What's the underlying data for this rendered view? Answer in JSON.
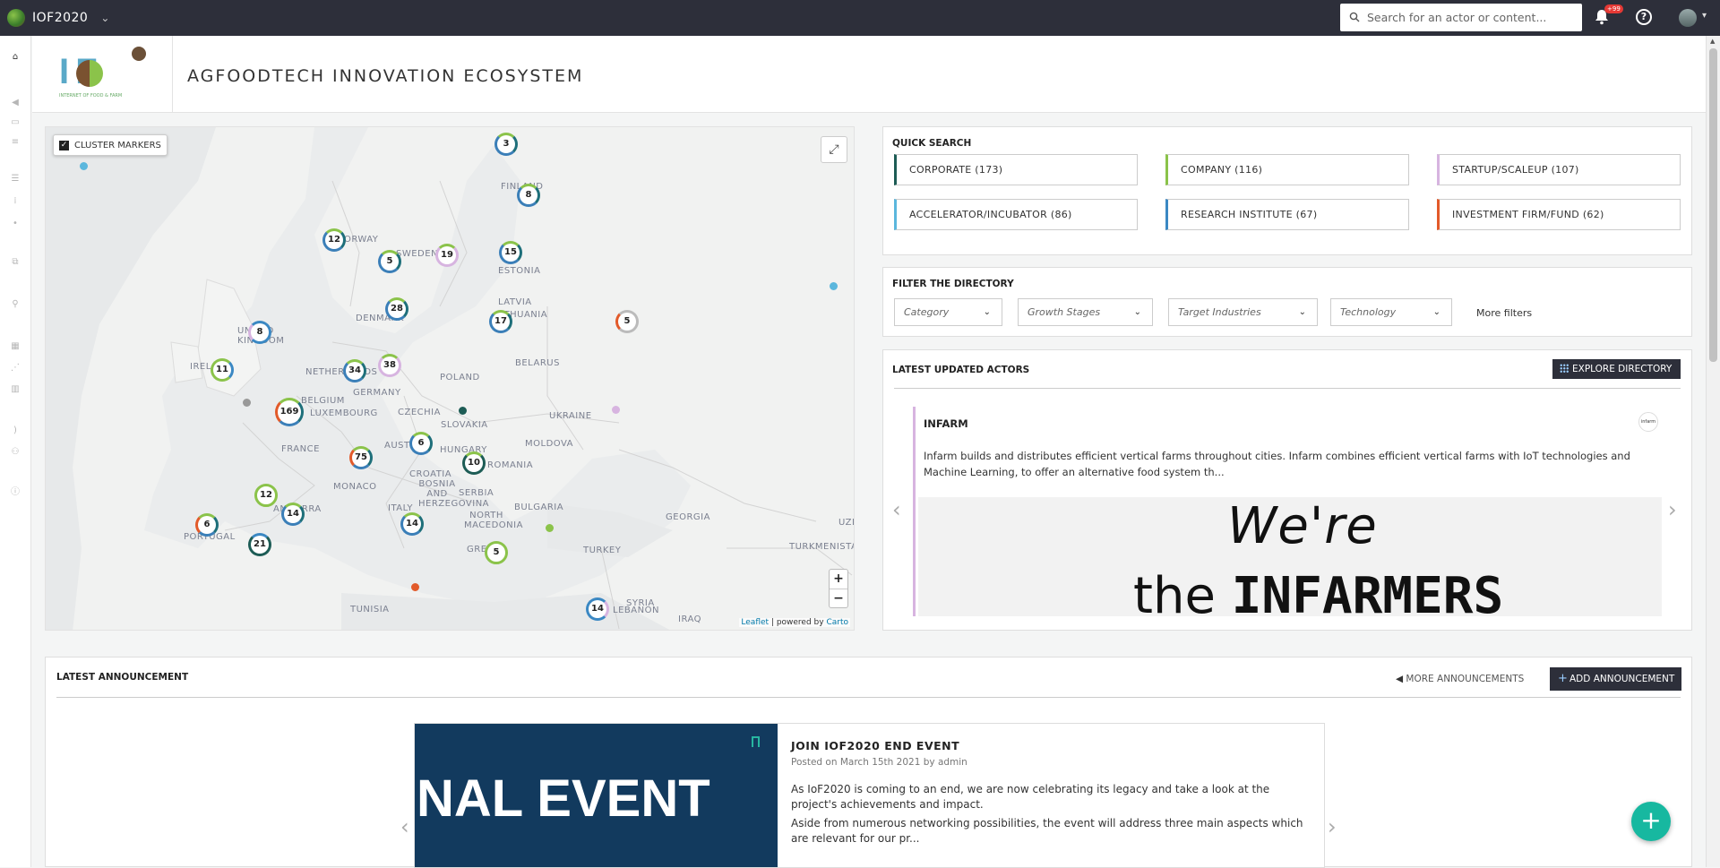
{
  "app": {
    "name": "IOF2020",
    "caret": "⌄"
  },
  "search": {
    "placeholder": "Search for an actor or content..."
  },
  "notifications": {
    "badge": "+99"
  },
  "help": {
    "label": "?"
  },
  "header": {
    "title": "AGFOODTECH INNOVATION ECOSYSTEM",
    "logo_sub": "INTERNET OF FOOD & FARM",
    "logo_text": "I F"
  },
  "map": {
    "cluster_label": "CLUSTER MARKERS",
    "fullscreen": "⤢",
    "zoom_in": "+",
    "zoom_out": "−",
    "attribution_leaflet": "Leaflet",
    "attribution_sep": " | powered by ",
    "attribution_carto": "Carto",
    "clusters": [
      "3",
      "8",
      "12",
      "5",
      "19",
      "15",
      "28",
      "17",
      "8",
      "11",
      "34",
      "38",
      "169",
      "6",
      "10",
      "75",
      "12",
      "14",
      "6",
      "21",
      "14",
      "5",
      "14",
      "5"
    ],
    "countries": [
      "FINLAND",
      "NORWAY",
      "SWEDEN",
      "ESTONIA",
      "LATVIA",
      "LITHUANIA",
      "DENMARK",
      "UNITED KINGDOM",
      "IRELAND",
      "NETHERLANDS",
      "BELGIUM",
      "LUXEMBOURG",
      "GERMANY",
      "POLAND",
      "BELARUS",
      "CZECHIA",
      "SLOVAKIA",
      "UKRAINE",
      "FRANCE",
      "AUSTRIA",
      "HUNGARY",
      "MOLDOVA",
      "CROATIA",
      "BOSNIA AND HERZEGOVINA",
      "ROMANIA",
      "MONACO",
      "ITALY",
      "SERBIA",
      "BULGARIA",
      "NORTH MACEDONIA",
      "GEORGIA",
      "ANDORRA",
      "PORTUGAL",
      "GREECE",
      "TURKEY",
      "TURKMENISTAN",
      "SYRIA",
      "LEBANON",
      "TUNISIA",
      "IRAQ",
      "UZB"
    ]
  },
  "quick_search": {
    "title": "QUICK SEARCH",
    "items": [
      {
        "label": "CORPORATE (173)",
        "color": "#1d5c55"
      },
      {
        "label": "COMPANY (116)",
        "color": "#8bc34a"
      },
      {
        "label": "STARTUP/SCALEUP (107)",
        "color": "#d7b4e0"
      },
      {
        "label": "ACCELERATOR/INCUBATOR (86)",
        "color": "#5bb7dd"
      },
      {
        "label": "RESEARCH INSTITUTE (67)",
        "color": "#3b88c3"
      },
      {
        "label": "INVESTMENT FIRM/FUND (62)",
        "color": "#e25a2a"
      }
    ]
  },
  "filters": {
    "title": "FILTER THE DIRECTORY",
    "dropdowns": [
      "Category",
      "Growth Stages",
      "Target Industries",
      "Technology"
    ],
    "more": "More filters"
  },
  "latest_actors": {
    "title": "LATEST UPDATED ACTORS",
    "explore": "EXPLORE DIRECTORY",
    "actor": {
      "name": "INFARM",
      "logo": "infarm",
      "description": "Infarm builds and distributes efficient vertical farms throughout cities. Infarm combines efficient vertical farms with IoT technologies and Machine Learning, to offer an alternative food system th...",
      "slogan_line1": "We're",
      "slogan_the": "the",
      "slogan_bold": "INFARMERS"
    }
  },
  "announcement": {
    "title": "LATEST ANNOUNCEMENT",
    "more": "MORE ANNOUNCEMENTS",
    "add": "ADD ANNOUNCEMENT",
    "card": {
      "image_text": "NAL EVENT",
      "heading": "JOIN IOF2020 END EVENT",
      "meta": "Posted on March 15th 2021 by admin",
      "body1": "As IoF2020 is coming to an end, we are now celebrating its legacy and take a look at the project's achievements and impact.",
      "body2": "Aside from numerous networking possibilities, the event will address three main aspects which are relevant for our pr..."
    }
  },
  "fab": {
    "label": "+"
  }
}
